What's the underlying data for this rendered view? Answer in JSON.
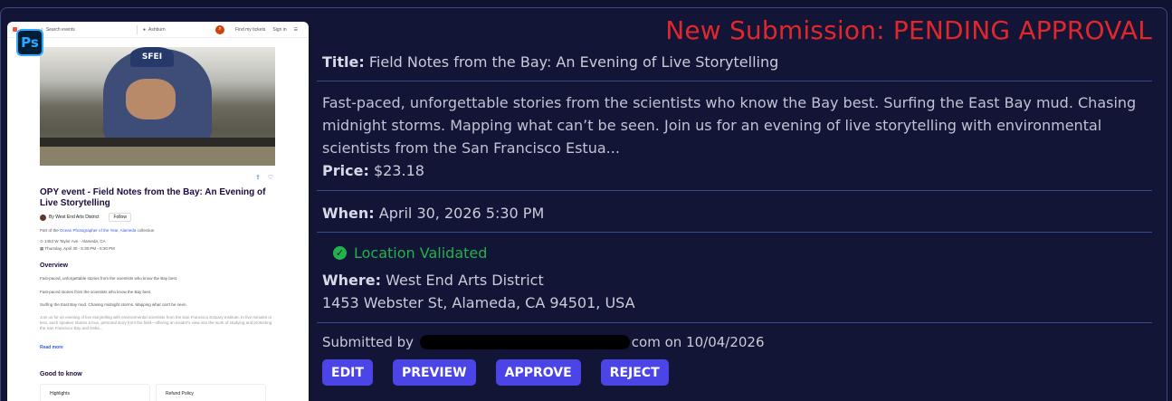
{
  "status": "New Submission: PENDING APPROVAL",
  "preview": {
    "app_badge": "Ps",
    "nav": {
      "search_placeholder": "Search events",
      "location": "Ashburn",
      "find_tickets": "Find my tickets",
      "sign_in": "Sign in"
    },
    "cap_text": "SFEI",
    "title": "OPY event - Field Notes from the Bay: An Evening of Live Storytelling",
    "organizer": "By West End Arts District",
    "follow": "Follow",
    "collection_prefix": "Part of the",
    "collection_link": "Ocean Photographer of the Year, Alameda",
    "collection_suffix": "collection",
    "address_line": "1453 W Taylor Ave · Alameda, CA",
    "date_line": "Thursday, April 30 · 5:30 PM - 8:30 PM",
    "overview_heading": "Overview",
    "overview_p1": "Fast-paced, unforgettable stories from the scientists who know the Bay best.",
    "overview_p2": "Fast-paced stories from the scientists who know the Bay best.",
    "overview_p3": "Surfing the East Bay mud. Chasing midnight storms. Mapping what can't be seen.",
    "overview_p4": "Join us for an evening of live storytelling with environmental scientists from the San Francisco Estuary Institute. In five minutes or less, each speaker shares a true, personal story from the field—offering an insider's view into the work of studying and protecting the San Francisco Bay and Delta...",
    "read_more": "Read more",
    "good_to_know": "Good to know",
    "highlights": "Highlights",
    "refund_policy": "Refund Policy"
  },
  "details": {
    "title_label": "Title:",
    "title_value": "Field Notes from the Bay: An Evening of Live Storytelling",
    "description": "Fast-paced, unforgettable stories from the scientists who know the Bay best. Surfing the East Bay mud. Chasing midnight storms. Mapping what can’t be seen. Join us for an evening of live storytelling with environmental scientists from the San Francisco Estua...",
    "price_label": "Price:",
    "price_value": "$23.18",
    "when_label": "When:",
    "when_value": "April 30, 2026 5:30 PM",
    "location_status": "Location Validated",
    "where_label": "Where:",
    "where_value": "West End Arts District",
    "address": "1453 Webster St, Alameda, CA 94501, USA",
    "submitted_prefix": "Submitted by",
    "submitted_email_tail": "com on 10/04/2026"
  },
  "actions": {
    "edit": "EDIT",
    "preview": "PREVIEW",
    "approve": "APPROVE",
    "reject": "REJECT"
  },
  "colors": {
    "background": "#121535",
    "status": "#e0282c",
    "button": "#4b44e6",
    "validated": "#22b24c",
    "divider": "#2f4d8c"
  }
}
